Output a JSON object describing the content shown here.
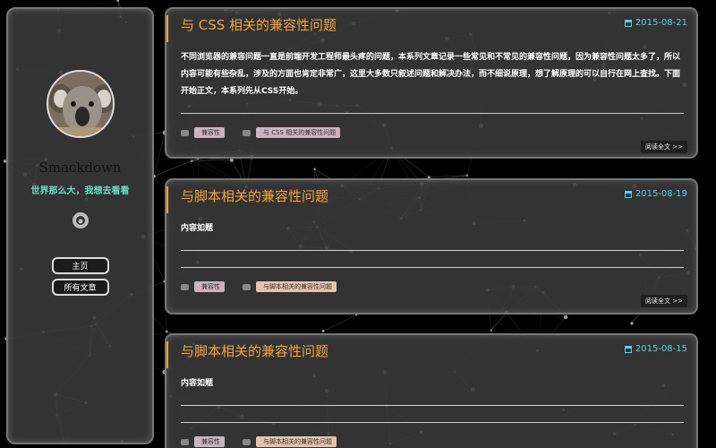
{
  "sidebar": {
    "site_name": "Smackdown",
    "motto": "世界那么大，我想去看看",
    "nav": [
      {
        "label": "主页"
      },
      {
        "label": "所有文章"
      }
    ]
  },
  "posts": [
    {
      "title": "与 CSS 相关的兼容性问题",
      "date": "2015-08-21",
      "body": "不同浏览器的兼容问题一直是前端开发工程师最头疼的问题，本系列文章记录一些常见和不常见的兼容性问题，因为兼容性问题太多了，所以内容可能有些杂乱，涉及的方面也肯定非常广，这里大多数只叙述问题和解决办法，而不细说原理，想了解原理的可以自行在网上查找。下面开始正文，本系列先从CSS开始。",
      "category": "兼容性",
      "tag": "与 CSS 相关的兼容性问题",
      "read_more": "阅读全文 >>"
    },
    {
      "title": "与脚本相关的兼容性问题",
      "date": "2015-08-19",
      "body": "内容如题",
      "category": "兼容性",
      "tag": "与脚本相关的兼容性问题",
      "read_more": "阅读全文 >>"
    },
    {
      "title": "与脚本相关的兼容性问题",
      "date": "2015-08-15",
      "body": "内容如题",
      "category": "兼容性",
      "tag": "与脚本相关的兼容性问题"
    }
  ],
  "colors": {
    "title": "#f2a43a",
    "date": "#4fd4e0",
    "motto": "#68e0c0"
  }
}
